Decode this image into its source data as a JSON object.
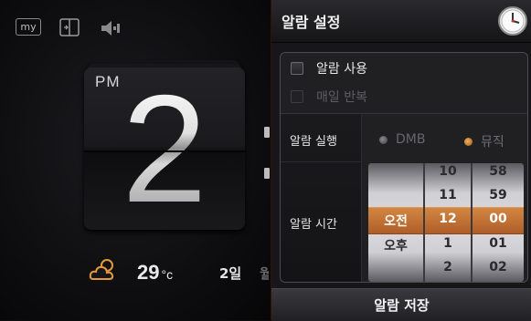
{
  "status_bar": {
    "my_label": "my"
  },
  "clock": {
    "ampm": "PM",
    "hour": "2"
  },
  "weather": {
    "temperature": "29",
    "unit": "°c",
    "day": "2일",
    "next_day_partial": "월"
  },
  "alarm": {
    "title": "알람 설정",
    "use_alarm_label": "알람 사용",
    "repeat_daily_label": "매일 반복",
    "execute_label": "알람 실행",
    "execute_options": [
      "DMB",
      "뮤직"
    ],
    "time_label": "알람 시간",
    "picker": {
      "ampm": [
        "",
        "오전",
        "오후",
        ""
      ],
      "hours": [
        "10",
        "11",
        "12",
        "1",
        "2"
      ],
      "minutes": [
        "58",
        "59",
        "00",
        "01",
        "02"
      ],
      "selected": {
        "ampm": "오전",
        "hour": "12",
        "minute": "00"
      }
    },
    "save_label": "알람 저장"
  },
  "colors": {
    "accent": "#d07a2a",
    "background": "#0b0b0d",
    "panel": "#202023"
  }
}
